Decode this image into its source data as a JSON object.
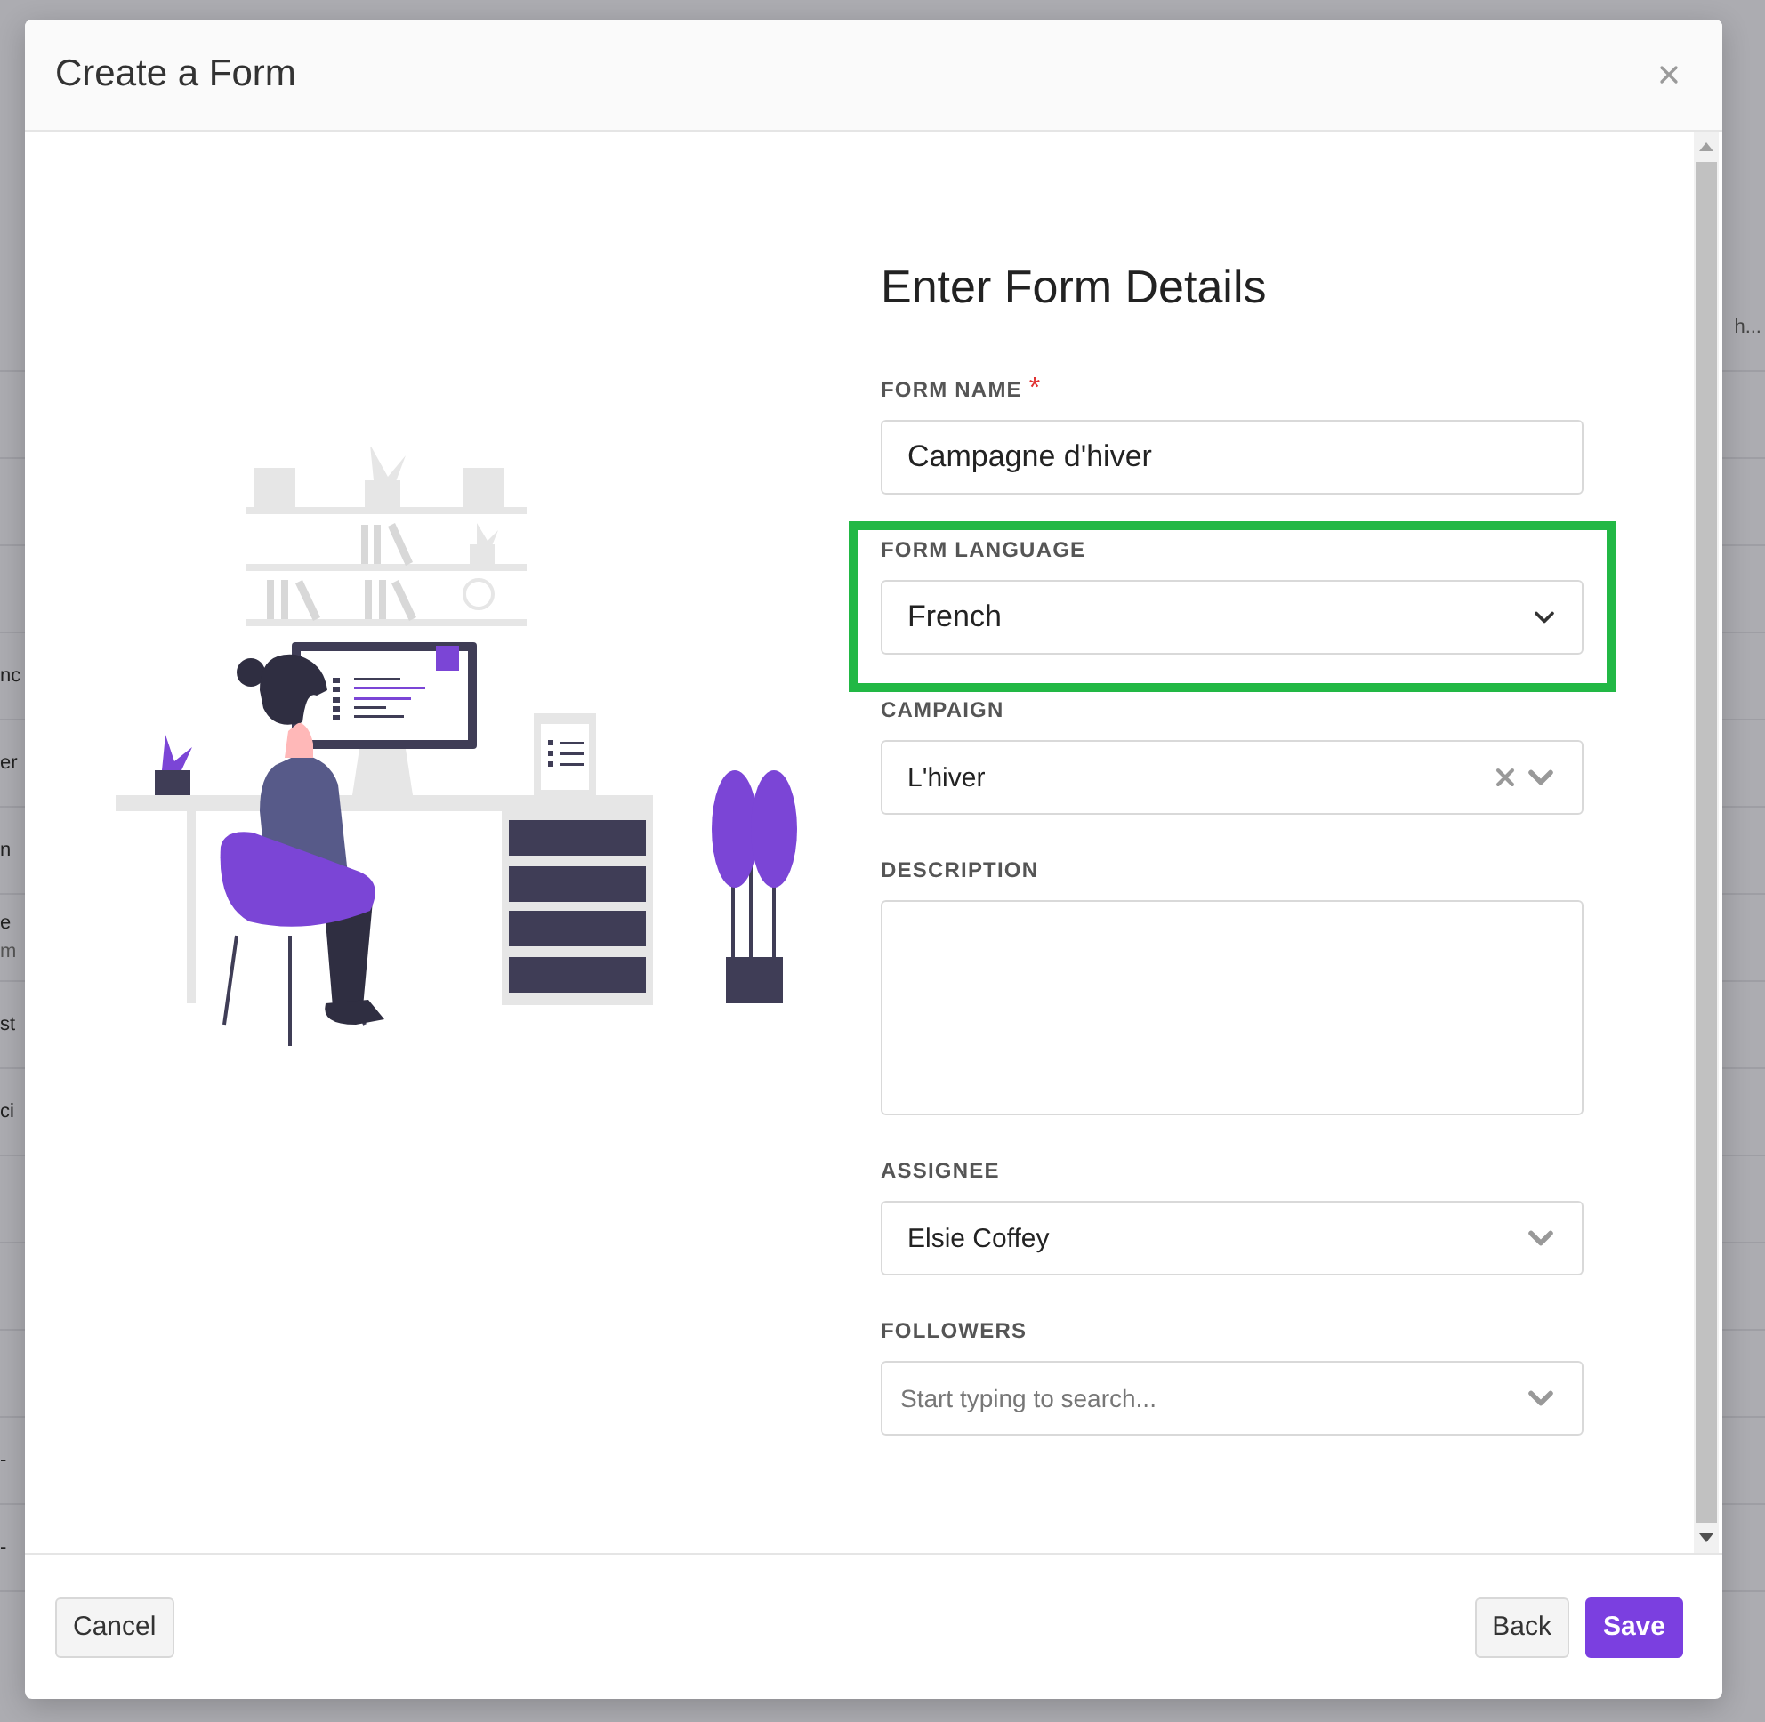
{
  "backdrop": {
    "rows": [
      {
        "right": "h..."
      },
      {},
      {},
      {},
      {
        "left": [
          "nc"
        ]
      },
      {
        "left": [
          "er"
        ]
      },
      {
        "left": [
          "n"
        ]
      },
      {
        "left": [
          "e",
          "m"
        ]
      },
      {
        "left": [
          "st"
        ]
      },
      {
        "left": [
          "ci"
        ]
      },
      {},
      {},
      {},
      {
        "left": [
          "-"
        ]
      },
      {
        "left": [
          "-"
        ]
      }
    ]
  },
  "dialog": {
    "title": "Create a Form",
    "heading": "Enter Form Details",
    "fields": [
      {
        "kind": "text",
        "label": "FORM NAME",
        "required_mark": "*",
        "value": "Campagne d'hiver",
        "highlighted": false
      },
      {
        "kind": "select",
        "label": "FORM LANGUAGE",
        "value": "French",
        "highlighted": true
      },
      {
        "kind": "combo",
        "label": "CAMPAIGN",
        "value": "L'hiver",
        "clearable": true,
        "highlighted": false
      },
      {
        "kind": "textarea",
        "label": "DESCRIPTION",
        "highlighted": false
      },
      {
        "kind": "combo",
        "label": "ASSIGNEE",
        "value": "Elsie Coffey",
        "clearable": false,
        "highlighted": false
      },
      {
        "kind": "combo",
        "label": "FOLLOWERS",
        "placeholder": "Start typing to search...",
        "clearable": false,
        "highlighted": false
      }
    ],
    "footer": {
      "left": [
        {
          "label": "Cancel",
          "kind": "default"
        }
      ],
      "right": [
        {
          "label": "Back",
          "kind": "default"
        },
        {
          "label": "Save",
          "kind": "primary"
        }
      ]
    }
  }
}
